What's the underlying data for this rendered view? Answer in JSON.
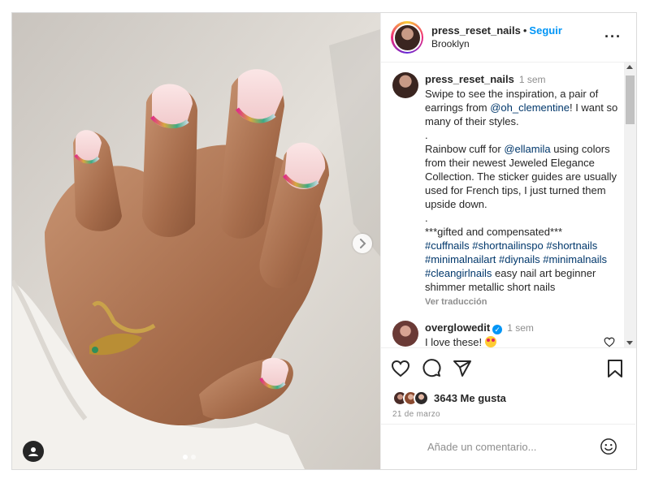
{
  "post": {
    "header": {
      "username": "press_reset_nails",
      "separator": "•",
      "follow_label": "Seguir",
      "location": "Brooklyn",
      "more_icon": "more-horizontal-icon"
    },
    "caption": {
      "username": "press_reset_nails",
      "timestamp": "1 sem",
      "text_part1": "Swipe to see the inspiration, a pair of earrings from ",
      "mention1": "@oh_clementine",
      "text_part2": "! I want so many of their styles.\n.\nRainbow cuff for ",
      "mention2": "@ellamila",
      "text_part3": " using colors from their newest Jeweled Elegance Collection. The sticker guides are usually used for French tips, I just turned them upside down.\n.\n***gifted and compensated***\n",
      "hashtags": "#cuffnails #shortnailinspo #shortnails #minimalnailart #diynails #minimalnails #cleangirlnails",
      "text_part4": " easy nail art beginner shimmer metallic short nails",
      "translate_label": "Ver traducción"
    },
    "comments": [
      {
        "username": "overglowedit",
        "verified": true,
        "timestamp": "1 sem",
        "text": "I love these! "
      }
    ],
    "actions": {
      "like_icon": "heart-icon",
      "comment_icon": "comment-icon",
      "share_icon": "send-icon",
      "save_icon": "bookmark-icon"
    },
    "likes": {
      "count_label": "3643 Me gusta"
    },
    "date": "21 de marzo",
    "add_comment": {
      "placeholder": "Añade un comentario...",
      "emoji_icon": "smiley-icon"
    },
    "media": {
      "next_icon": "chevron-right-icon",
      "tag_icon": "user-tag-icon",
      "carousel_total": 2,
      "carousel_current": 1
    },
    "colors": {
      "accent": "#0095f6",
      "link": "#00376b",
      "muted": "#8e8e8e"
    }
  }
}
